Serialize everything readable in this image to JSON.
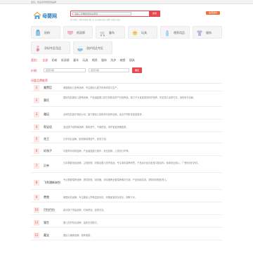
{
  "topbar": {
    "text": "您好，欢迎来到母婴用品网"
  },
  "header": {
    "brand": "母婴网",
    "search_placeholder": "请输入您要搜索的关键词",
    "search_button": "搜索",
    "tagline": "热门搜索：奶粉 纸尿裤 婴儿车 安全座椅 玩具 辅食 孕妇装 奶瓶",
    "hotline": "免费发布"
  },
  "categories": [
    {
      "label": "奶粉",
      "icon": "milk-powder-icon"
    },
    {
      "label": "纸尿裤",
      "icon": "diaper-icon"
    },
    {
      "label": "童车",
      "icon": "stroller-icon"
    },
    {
      "label": "玩具",
      "icon": "toy-icon"
    },
    {
      "label": "喂养用品",
      "icon": "bottle-icon"
    },
    {
      "label": "服饰",
      "icon": "clothes-icon"
    },
    {
      "label": "孕妈专区用品",
      "icon": "maternity-icon"
    },
    {
      "label": "洗护用品专区",
      "icon": "bath-icon"
    }
  ],
  "filters": {
    "row1": {
      "key": "类别：",
      "values": [
        "全部",
        "奶粉",
        "纸尿裤",
        "童车",
        "玩具",
        "喂养",
        "服饰",
        "洗护",
        "辅食",
        "寝具"
      ]
    },
    "row2": {
      "key": "地区：",
      "values": [
        "全部",
        "北京",
        "上海",
        "广州",
        "深圳",
        "杭州",
        "成都",
        "武汉",
        "南京"
      ]
    },
    "row3": {
      "key": "价格：",
      "min_placeholder": "最低价格",
      "max_placeholder": "最高价格",
      "button": "确定"
    }
  },
  "section_title": "母婴品牌推荐",
  "rows": [
    {
      "num": "1",
      "name": "美赞臣",
      "desc": "美国婴幼儿营养品牌，专注婴幼儿配方奶粉研发与生产。"
    },
    {
      "num": "2",
      "name": "惠氏",
      "desc": "国际知名婴幼儿营养品牌，产品涵盖婴儿配方奶粉及孕产妇营养品，致力于为宝宝提供科学营养，历史悠久品质可靠，深受家长信赖。"
    },
    {
      "num": "3",
      "name": "雅培",
      "desc": "全球知名医疗保健公司，旗下婴幼儿奶粉系列营养全面，适合不同阶段宝宝需求。"
    },
    {
      "num": "4",
      "name": "帮宝适",
      "desc": "宝洁旗下纸尿裤品牌，柔软透气，干爽舒适，呵护宝宝娇嫩肌肤。"
    },
    {
      "num": "5",
      "name": "花王",
      "desc": "日本知名品牌，纸尿裤轻薄透气，吸收力强。"
    },
    {
      "num": "6",
      "name": "好孩子",
      "desc": "中国童车领导品牌，产品涵盖婴儿推车、安全座椅、儿童自行车等。"
    },
    {
      "num": "7",
      "name": "贝亲",
      "desc": "日本母婴用品品牌，主营奶瓶、奶嘴及婴儿洗护用品，专注母乳喂养研究，产品设计贴合宝宝口腔结构，使用安全放心，广受妈妈们好评。"
    },
    {
      "num": "8",
      "name": "飞利浦新安怡",
      "desc": "专业母婴喂养品牌，提供奶瓶、吸奶器、消毒器等全套喂养解决方案，产品创新实用，帮助妈妈轻松育儿。"
    },
    {
      "num": "9",
      "name": "费雪",
      "desc": "美国玩具品牌，专注婴幼儿早教益智玩具，伴随宝宝快乐成长，寓教于乐。"
    },
    {
      "num": "10",
      "name": "巴拉巴拉",
      "desc": "森马旗下童装品牌，时尚舒适，品质可靠。"
    },
    {
      "num": "11",
      "name": "强生",
      "desc": "婴儿洗护知名品牌，温和无泪配方。"
    },
    {
      "num": "12",
      "name": "嘉宝",
      "desc": "婴幼儿辅食品牌，营养健康。"
    }
  ],
  "colors": {
    "accent": "#e5494f",
    "brand": "#2b7fb7",
    "hotline": "#f0713a"
  }
}
